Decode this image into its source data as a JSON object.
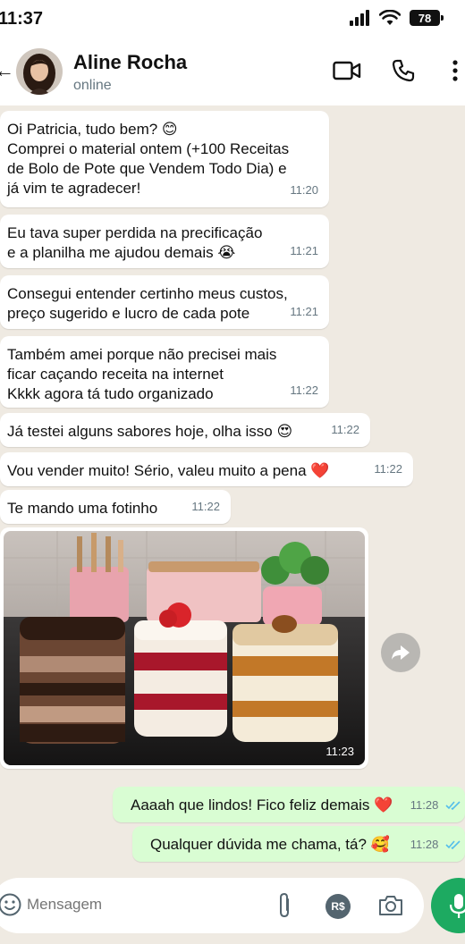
{
  "status": {
    "time": "11:37",
    "battery": "78"
  },
  "header": {
    "back": "←",
    "name": "Aline Rocha",
    "presence": "online"
  },
  "messages": [
    {
      "lines": [
        "Oi Patricia, tudo bem? 😊",
        "Comprei o material ontem (+100 Receitas",
        "de Bolo de Pote que Vendem Todo Dia) e",
        "já vim te agradecer!"
      ],
      "time": "11:20"
    },
    {
      "lines": [
        "Eu tava super perdida na precificação",
        "e a planilha me ajudou demais 😭"
      ],
      "time": "11:21"
    },
    {
      "lines": [
        "Consegui entender certinho meus custos,",
        "preço sugerido e lucro de cada pote"
      ],
      "time": "11:21"
    },
    {
      "lines": [
        "Também amei porque não precisei mais",
        "ficar caçando receita na internet",
        "Kkkk agora tá tudo organizado"
      ],
      "time": "11:22"
    },
    {
      "lines": [
        "Já testei alguns sabores hoje, olha isso 😍"
      ],
      "time": "11:22"
    },
    {
      "lines": [
        "Vou vender muito! Sério, valeu muito a pena ❤️"
      ],
      "time": "11:22"
    },
    {
      "lines": [
        "Te mando uma fotinho"
      ],
      "time": "11:22"
    }
  ],
  "photo": {
    "time": "11:23"
  },
  "outgoing": [
    {
      "text": "Aaaah que lindos! Fico feliz demais ❤️",
      "time": "11:28"
    },
    {
      "text": "Qualquer dúvida me chama, tá? 🥰",
      "time": "11:28"
    }
  ],
  "input": {
    "placeholder": "Mensagem"
  },
  "colors": {
    "incoming": "#ffffff",
    "outgoing": "#d9fdd3",
    "wallpaper": "#efeae2",
    "accent": "#1daa61",
    "read_ticks": "#53bdeb"
  }
}
